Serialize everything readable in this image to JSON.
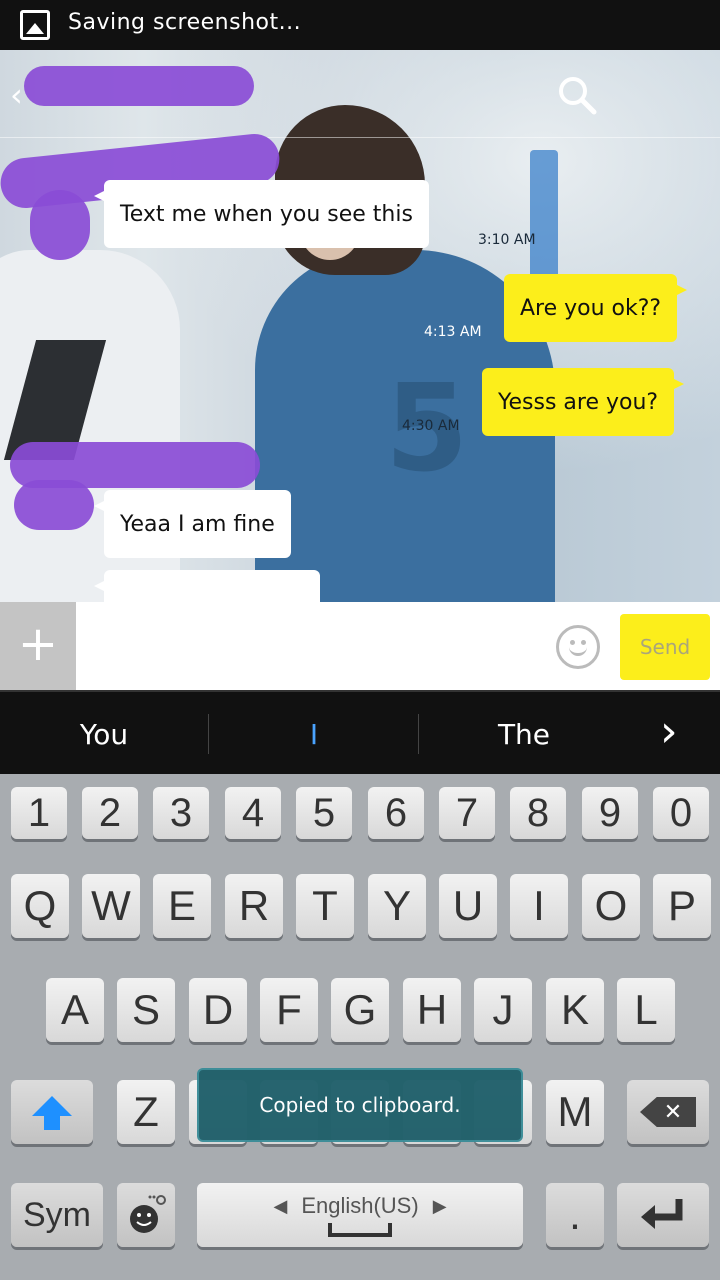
{
  "status_bar": {
    "text": "Saving screenshot..."
  },
  "chat": {
    "messages": [
      {
        "text": "Text me when you see this",
        "time": "3:10 AM",
        "from": "them"
      },
      {
        "text": "Are you ok??",
        "time": "4:13 AM",
        "from": "me"
      },
      {
        "text": "Yesss are you?",
        "time": "4:30 AM",
        "from": "me"
      },
      {
        "text": "Yeaa I am fine",
        "time": "",
        "from": "them"
      }
    ]
  },
  "input": {
    "placeholder": "",
    "send_label": "Send"
  },
  "suggestions": {
    "items": [
      "You",
      "I",
      "The"
    ]
  },
  "keyboard": {
    "number_row": [
      "1",
      "2",
      "3",
      "4",
      "5",
      "6",
      "7",
      "8",
      "9",
      "0"
    ],
    "row1": [
      "Q",
      "W",
      "E",
      "R",
      "T",
      "Y",
      "U",
      "I",
      "O",
      "P"
    ],
    "row2": [
      "A",
      "S",
      "D",
      "F",
      "G",
      "H",
      "J",
      "K",
      "L"
    ],
    "row3_left": [
      "Z"
    ],
    "row3_right": [
      "M"
    ],
    "sym_label": "Sym",
    "language_label": "English(US)",
    "period_label": "."
  },
  "toast": {
    "text": "Copied to clipboard."
  },
  "colors": {
    "accent_yellow": "#fcee1b",
    "shift_blue": "#1e90ff",
    "redaction_purple": "#8a4cd6"
  }
}
